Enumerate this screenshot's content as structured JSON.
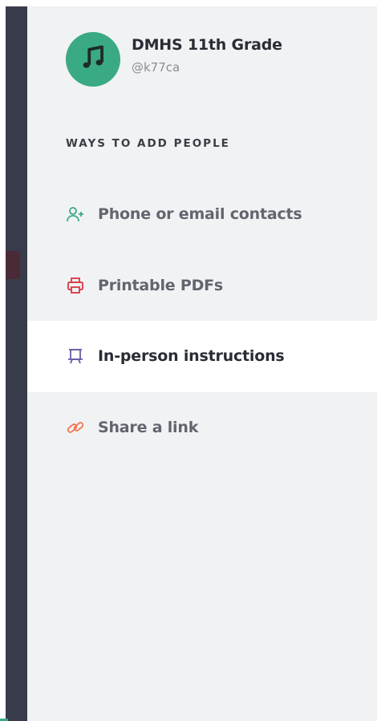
{
  "class": {
    "name": "DMHS 11th Grade",
    "handle": "@k77ca",
    "avatar_icon": "music-note-icon",
    "avatar_color": "#3aaa84"
  },
  "section": {
    "title": "WAYS TO ADD PEOPLE"
  },
  "menu": {
    "items": [
      {
        "label": "Phone or email contacts",
        "icon": "add-person-icon",
        "icon_color": "#3aaa84",
        "active": false
      },
      {
        "label": "Printable PDFs",
        "icon": "printer-icon",
        "icon_color": "#d9404a",
        "active": false
      },
      {
        "label": "In-person instructions",
        "icon": "presentation-board-icon",
        "icon_color": "#6b5aa8",
        "active": true
      },
      {
        "label": "Share a link",
        "icon": "link-icon",
        "icon_color": "#f07850",
        "active": false
      }
    ]
  },
  "colors": {
    "panel_bg": "#f1f2f4",
    "active_bg": "#ffffff",
    "left_strip": "#383c4a",
    "text_dark": "#2a2c35",
    "text_muted": "#62656e"
  }
}
